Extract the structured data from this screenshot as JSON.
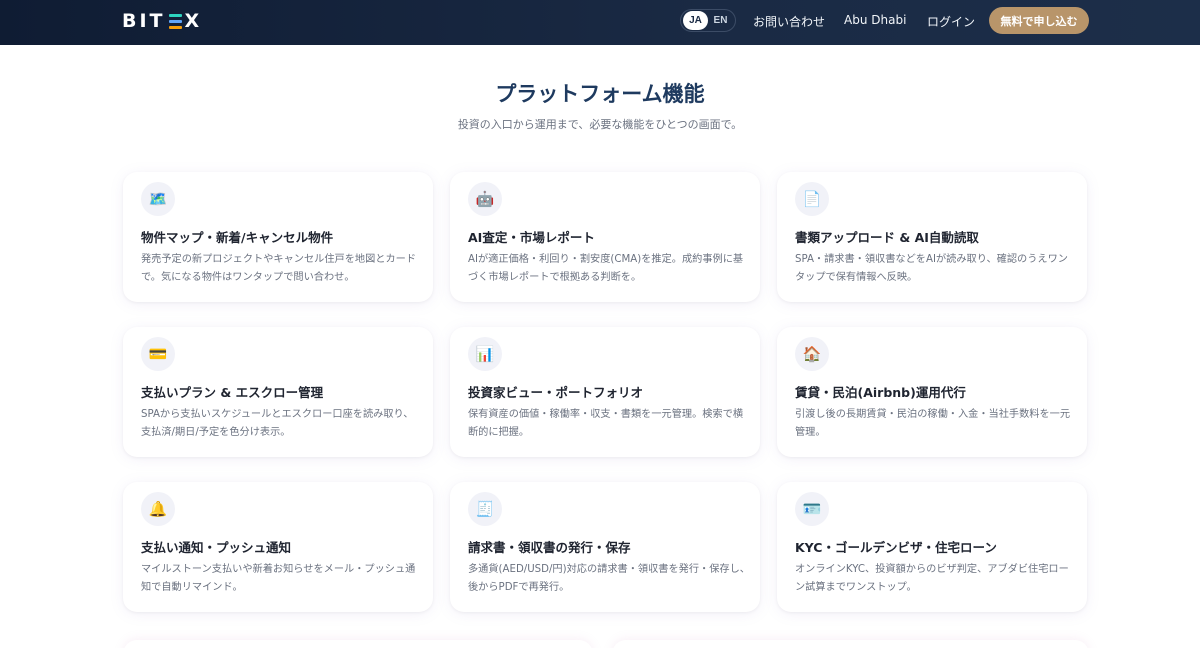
{
  "header": {
    "logo": "BITEX",
    "lang_ja": "JA",
    "lang_en": "EN",
    "contact": "お問い合わせ",
    "region": "Abu Dhabi",
    "login": "ログイン",
    "signup": "無料で申し込む"
  },
  "section": {
    "title": "プラットフォーム機能",
    "subtitle": "投資の入口から運用まで、必要な機能をひとつの画面で。"
  },
  "features": [
    {
      "icon": "map-icon",
      "emoji": "🗺️",
      "title": "物件マップ・新着/キャンセル物件",
      "description": "発売予定の新プロジェクトやキャンセル住戸を地図とカードで。気になる物件はワンタップで問い合わせ。"
    },
    {
      "icon": "ai-robot-icon",
      "emoji": "🤖",
      "title": "AI査定・市場レポート",
      "description": "AIが適正価格・利回り・割安度(CMA)を推定。成約事例に基づく市場レポートで根拠ある判断を。"
    },
    {
      "icon": "document-icon",
      "emoji": "📄",
      "title": "書類アップロード & AI自動読取",
      "description": "SPA・請求書・領収書などをAIが読み取り、確認のうえワンタップで保有情報へ反映。"
    },
    {
      "icon": "credit-card-icon",
      "emoji": "💳",
      "title": "支払いプラン & エスクロー管理",
      "description": "SPAから支払いスケジュールとエスクロー口座を読み取り、支払済/期日/予定を色分け表示。"
    },
    {
      "icon": "bar-chart-icon",
      "emoji": "📊",
      "title": "投資家ビュー・ポートフォリオ",
      "description": "保有資産の価値・稼働率・収支・書類を一元管理。検索で横断的に把握。"
    },
    {
      "icon": "house-icon",
      "emoji": "🏠",
      "title": "賃貸・民泊(Airbnb)運用代行",
      "description": "引渡し後の長期賃貸・民泊の稼働・入金・当社手数料を一元管理。"
    },
    {
      "icon": "bell-icon",
      "emoji": "🔔",
      "title": "支払い通知・プッシュ通知",
      "description": "マイルストーン支払いや新着お知らせをメール・プッシュ通知で自動リマインド。"
    },
    {
      "icon": "receipt-icon",
      "emoji": "🧾",
      "title": "請求書・領収書の発行・保存",
      "description": "多通貨(AED/USD/円)対応の請求書・領収書を発行・保存し、後からPDFで再発行。"
    },
    {
      "icon": "id-card-icon",
      "emoji": "🪪",
      "title": "KYC・ゴールデンビザ・住宅ローン",
      "description": "オンラインKYC、投資額からのビザ判定、アブダビ住宅ローン試算までワンストップ。"
    }
  ]
}
